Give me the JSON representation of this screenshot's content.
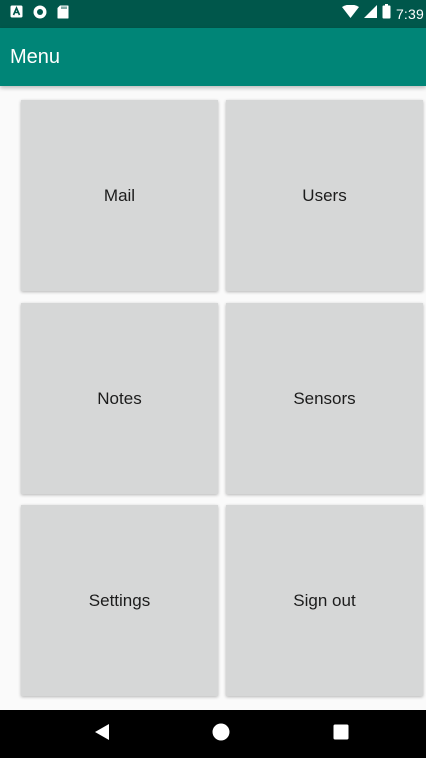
{
  "status_bar": {
    "time": "7:39",
    "icons": [
      "notification-a-icon",
      "circle-notification-icon",
      "sd-card-icon",
      "wifi-icon",
      "cell-signal-icon",
      "battery-icon"
    ]
  },
  "app_bar": {
    "title": "Menu"
  },
  "menu": {
    "tiles": [
      {
        "label": "Mail"
      },
      {
        "label": "Users"
      },
      {
        "label": "Notes"
      },
      {
        "label": "Sensors"
      },
      {
        "label": "Settings"
      },
      {
        "label": "Sign out"
      }
    ]
  },
  "nav_bar": {
    "icons": [
      "back-icon",
      "home-icon",
      "recents-icon"
    ]
  },
  "colors": {
    "status_bar": "#00574b",
    "app_bar": "#008577",
    "tile": "#d6d7d7",
    "background": "#fafafa",
    "nav_bar": "#000000"
  }
}
